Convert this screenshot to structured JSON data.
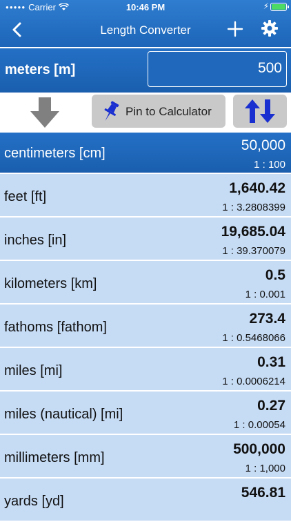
{
  "status": {
    "carrier": "Carrier",
    "time": "10:46 PM"
  },
  "nav": {
    "title": "Length Converter",
    "icons": [
      "chevron-left-icon",
      "plus-icon",
      "gear-icon"
    ]
  },
  "input": {
    "unit_label": "meters [m]",
    "value": "500"
  },
  "toolbar": {
    "pin_label": "Pin to Calculator",
    "icons": [
      "arrow-down-icon",
      "pin-icon",
      "swap-icon"
    ]
  },
  "units": [
    {
      "name": "centimeters [cm]",
      "value": "50,000",
      "ratio": "1 : 100"
    },
    {
      "name": "feet [ft]",
      "value": "1,640.42",
      "ratio": "1 : 3.2808399"
    },
    {
      "name": "inches [in]",
      "value": "19,685.04",
      "ratio": "1 : 39.370079"
    },
    {
      "name": "kilometers [km]",
      "value": "0.5",
      "ratio": "1 : 0.001"
    },
    {
      "name": "fathoms [fathom]",
      "value": "273.4",
      "ratio": "1 : 0.5468066"
    },
    {
      "name": "miles [mi]",
      "value": "0.31",
      "ratio": "1 : 0.0006214"
    },
    {
      "name": "miles (nautical) [mi]",
      "value": "0.27",
      "ratio": "1 : 0.00054"
    },
    {
      "name": "millimeters [mm]",
      "value": "500,000",
      "ratio": "1 : 1,000"
    },
    {
      "name": "yards [yd]",
      "value": "546.81",
      "ratio": ""
    }
  ],
  "colors": {
    "nav_blue": "#1d65b8",
    "row_light": "#c6dcf5",
    "button_gray": "#c9c9c9",
    "pin_blue": "#1a2fd0"
  }
}
